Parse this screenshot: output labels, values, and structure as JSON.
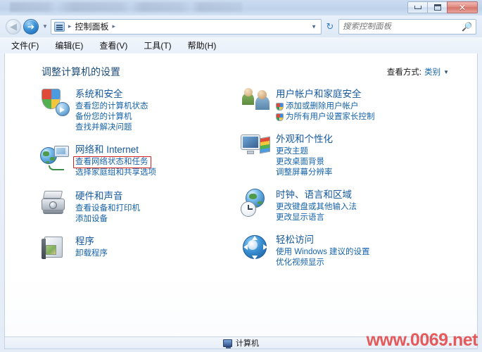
{
  "window": {
    "minimize_label": "最小化",
    "maximize_label": "最大化",
    "close_label": "✕"
  },
  "address": {
    "back_glyph": "◀",
    "forward_glyph": "➔",
    "history_caret": "▼",
    "icon_name": "control-panel-icon",
    "crumb": "控制面板",
    "separator": "▸",
    "dropdown_caret": "▼",
    "refresh_glyph": "↻"
  },
  "search": {
    "placeholder": "搜索控制面板",
    "icon": "🔎"
  },
  "menubar": {
    "items": [
      {
        "label": "文件(F)",
        "name": "menu-file"
      },
      {
        "label": "编辑(E)",
        "name": "menu-edit"
      },
      {
        "label": "查看(V)",
        "name": "menu-view"
      },
      {
        "label": "工具(T)",
        "name": "menu-tools"
      },
      {
        "label": "帮助(H)",
        "name": "menu-help"
      }
    ]
  },
  "page": {
    "heading": "调整计算机的设置",
    "view_by_label": "查看方式:",
    "view_by_value": "类别",
    "view_by_caret": "▼"
  },
  "categories": {
    "left": [
      {
        "title": "系统和安全",
        "links": [
          "查看您的计算机状态",
          "备份您的计算机",
          "查找并解决问题"
        ]
      },
      {
        "title": "网络和 Internet",
        "links": [
          "查看网络状态和任务",
          "选择家庭组和共享选项"
        ]
      },
      {
        "title": "硬件和声音",
        "links": [
          "查看设备和打印机",
          "添加设备"
        ]
      },
      {
        "title": "程序",
        "links": [
          "卸载程序"
        ]
      }
    ],
    "right": [
      {
        "title": "用户帐户和家庭安全",
        "links": [
          "添加或删除用户帐户",
          "为所有用户设置家长控制"
        ]
      },
      {
        "title": "外观和个性化",
        "links": [
          "更改主题",
          "更改桌面背景",
          "调整屏幕分辨率"
        ]
      },
      {
        "title": "时钟、语言和区域",
        "links": [
          "更改键盘或其他输入法",
          "更改显示语言"
        ]
      },
      {
        "title": "轻松访问",
        "links": [
          "使用 Windows 建议的设置",
          "优化视频显示"
        ]
      }
    ]
  },
  "highlight": {
    "target": "查看网络状态和任务",
    "color": "#d02020"
  },
  "statusbar": {
    "text": "计算机"
  },
  "watermark": {
    "text": "www.0069.net",
    "color": "#e22626"
  }
}
